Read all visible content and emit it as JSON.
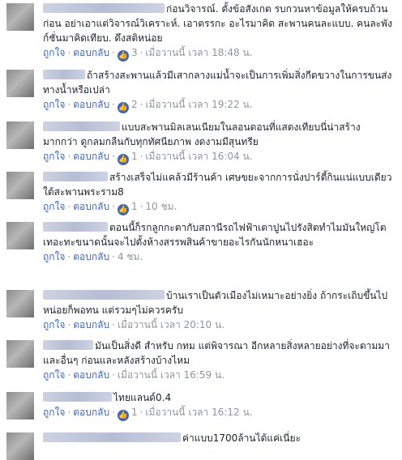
{
  "ui": {
    "like_label": "ถูกใจ",
    "reply_label": "ตอบกลับ",
    "dot": "·"
  },
  "comments": [
    {
      "name_width": 150,
      "text": "ก่อนวิจารณ์. ตั้งข้อสังเกต รบกวนหาข้อมูลให้ครบถ้วน ก่อน อย่าเอาแต่วิจารณ์วิเคราะห์. เอาตรรกะ อะไรมาคิด สะพานคนละแบบ. คนละพังก์ชั่นมาคิดเทียบ. ดึงสติหน่อย",
      "likes": "3",
      "time": "เมื่อวานนี้ เวลา 18:48 น."
    },
    {
      "name_width": 52,
      "text": "ถ้าสร้างสะพานแล้วมีเสากลางแม่น้ำจะเป็นการเพิ่มสิ่งกีดขวางในการขนส่งทางน้ำหรือเปล่า",
      "likes": "2",
      "time": "เมื่อวานนี้ เวลา 19:22 น."
    },
    {
      "name_width": 95,
      "text": "แบบสะพานมิลเลนเนียมในลอนดอนที่แสดงเทียบนี่น่าสร้างมากกว่า ดูกลมกลืนกับทุกทัศนียภาพ งดงามมีสุนทรีย",
      "likes": "1",
      "time": "เมื่อวานนี้ เวลา 16:04 น."
    },
    {
      "name_width": 80,
      "text": "สร้างเสร็จไม่แคล้วมีร้านค้า เศษขยะจากการนั่งปาร์ตี้กินแน่แบบเดียวใต้สะพานพระราม8",
      "likes": "1",
      "time": "10 ชม."
    },
    {
      "name_width": 80,
      "text": "ตอนนี้ก็รกลูกกะตากับสถานีรถไฟฟ้าเตาปูนไปรังสิตทำไมมันใหญ่โตเทอะทะขนาดนั้นจะไปตั้งห้างสรรพสินค้าขายอะไรกันนักหนาเฮอะ",
      "likes": "",
      "time": "4 ชม."
    },
    {
      "name_width": 150,
      "text": "บ้านเราเป็นตัวเมืองไม่เหมาะอย่างยิ่ง ถ้ากระเถิบขึ้นไปหน่อยก็พอทน แต่รวมๆไม่ควรครับ",
      "likes": "",
      "time": "เมื่อวานนี้ เวลา 20:10 น."
    },
    {
      "name_width": 62,
      "text": "มันเป็นสิ่งดี สำหรับ กทม แต่พิจารณา อีกหลายสิ่งหลายอย่างที่จะตามมาและอื่นๆ ก่อนและหลังสร้างบ้างไหม",
      "likes": "",
      "time": "เมื่อวานนี้ เวลา 16:59 น."
    },
    {
      "name_width": 85,
      "text": "ไทยแลนด์0.4",
      "likes": "1",
      "time": "เมื่อวานนี้ เวลา 16:12 น."
    },
    {
      "name_width": 170,
      "text": "ค่าแบบ1700ล้านได้แค่เนี่ยะ",
      "likes": "",
      "time": ""
    }
  ]
}
